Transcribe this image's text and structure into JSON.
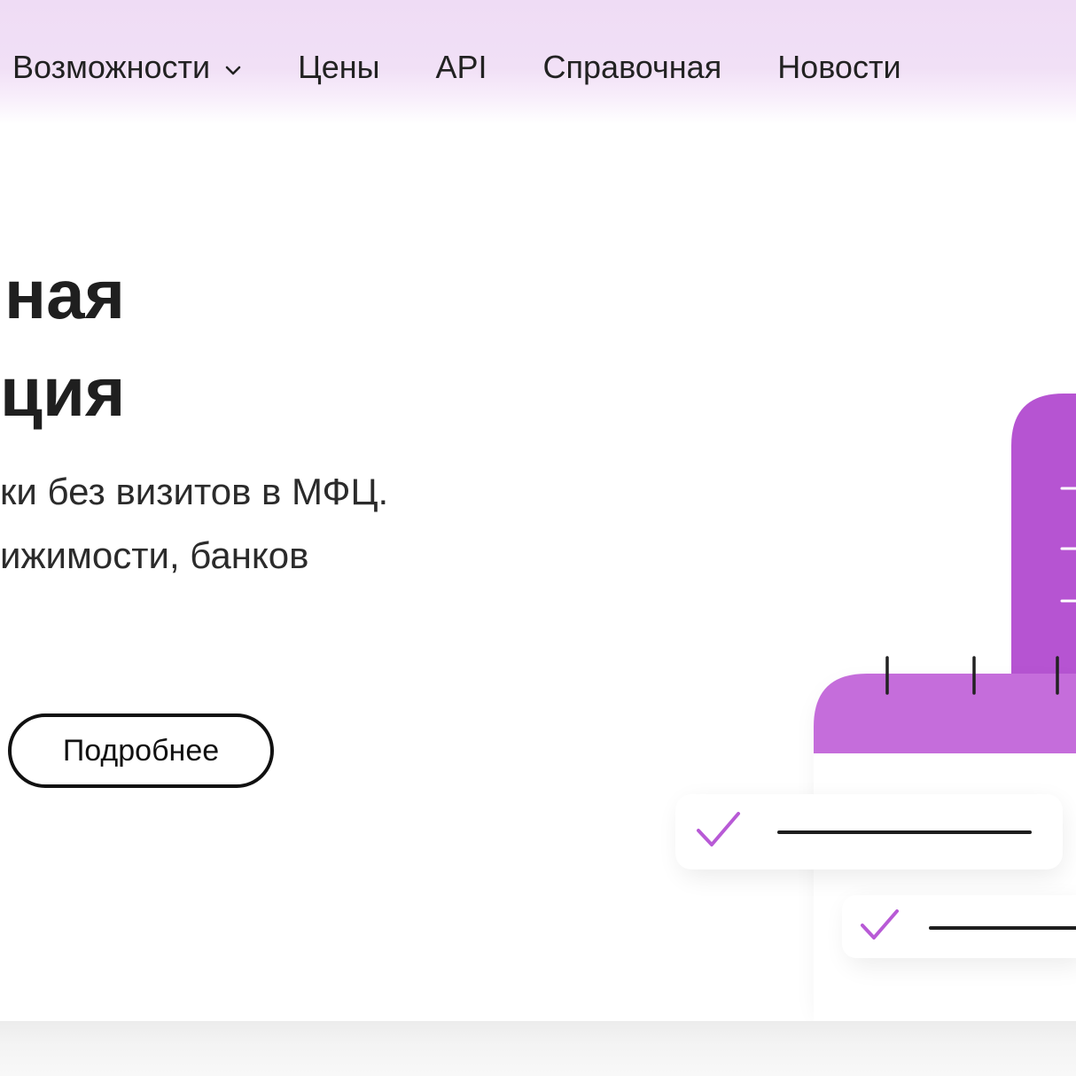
{
  "nav": {
    "items": [
      {
        "label": "Возможности",
        "has_dropdown": true
      },
      {
        "label": "Цены"
      },
      {
        "label": "API"
      },
      {
        "label": "Справочная"
      },
      {
        "label": "Новости"
      }
    ]
  },
  "hero": {
    "title_line1": "ная",
    "title_line2": "ция",
    "subtitle_line1": "ки без визитов в МФЦ.",
    "subtitle_line2": "ижимости, банков",
    "button_label": "Подробнее"
  },
  "illustration": {
    "icons": [
      "calendar-icon",
      "checkmark-icon"
    ],
    "colors": {
      "primary_purple": "#b654d2",
      "light_purple": "#c56ddb",
      "check_purple": "#b85ad6"
    }
  },
  "colors": {
    "topbar_bg": "#efdcf5",
    "text": "#1f1f1f",
    "button_border": "#111111"
  }
}
